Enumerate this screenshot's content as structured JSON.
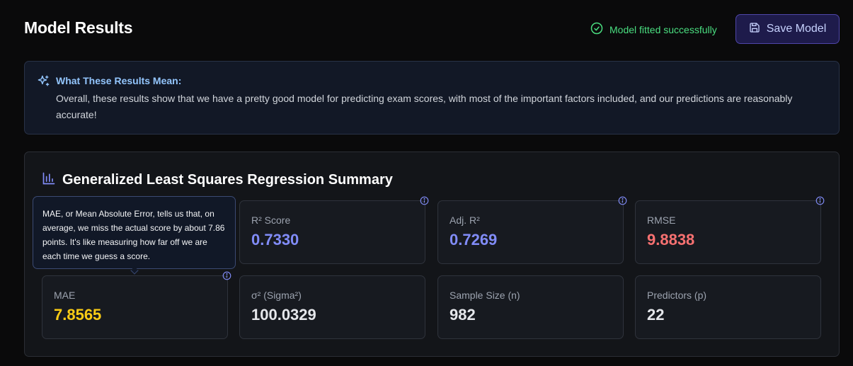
{
  "header": {
    "title": "Model Results",
    "status_text": "Model fitted successfully",
    "save_label": "Save Model"
  },
  "insight": {
    "heading": "What These Results Mean:",
    "body": "Overall, these results show that we have a pretty good model for predicting exam scores, with most of the important factors included, and our predictions are reasonably accurate!"
  },
  "summary": {
    "title": "Generalized Least Squares Regression Summary",
    "metrics": [
      {
        "label": "R² Score",
        "value": "0.7330",
        "color": "#818cf8"
      },
      {
        "label": "Adj. R²",
        "value": "0.7269",
        "color": "#818cf8"
      },
      {
        "label": "RMSE",
        "value": "9.8838",
        "color": "#f87171"
      },
      {
        "label": "MAE",
        "value": "7.8565",
        "color": "#facc15"
      },
      {
        "label": "σ² (Sigma²)",
        "value": "100.0329",
        "color": "#e5e7eb"
      },
      {
        "label": "Sample Size (n)",
        "value": "982",
        "color": "#e5e7eb"
      },
      {
        "label": "Predictors (p)",
        "value": "22",
        "color": "#e5e7eb"
      }
    ]
  },
  "tooltip": {
    "text": "MAE, or Mean Absolute Error, tells us that, on average, we miss the actual score by about 7.86 points. It's like measuring how far off we are each time we guess a score."
  },
  "colors": {
    "accent": "#818cf8",
    "success": "#4ade80",
    "error": "#f87171",
    "warning": "#facc15"
  },
  "icons": {
    "status": "check-circle-icon",
    "save": "save-icon",
    "insight": "sparkles-icon",
    "summary": "bar-chart-icon",
    "info": "info-icon"
  }
}
